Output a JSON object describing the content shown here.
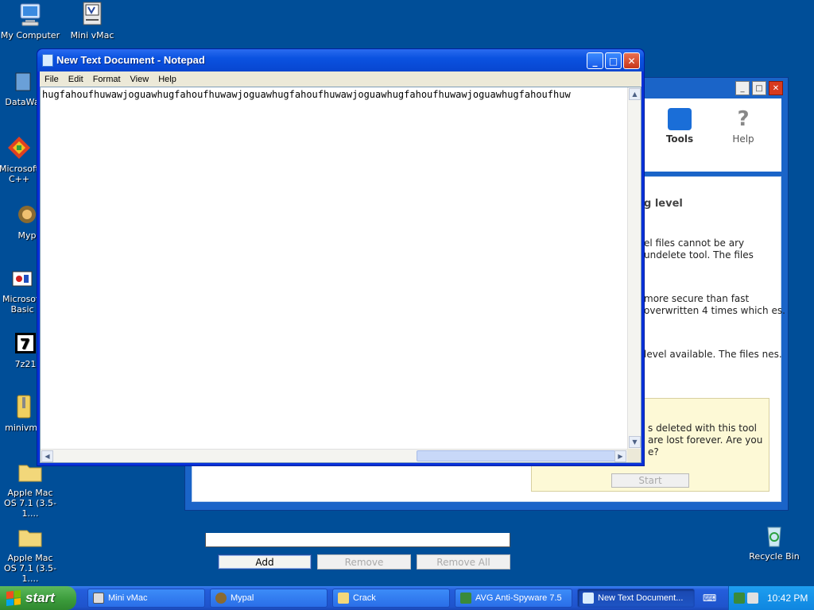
{
  "desktop": {
    "icons": [
      {
        "label": "My Computer"
      },
      {
        "label": "Mini vMac"
      },
      {
        "label": "DataWa"
      },
      {
        "label": "Microsoft C++"
      },
      {
        "label": "Myp"
      },
      {
        "label": "Microsoft Basic"
      },
      {
        "label": "7z21"
      },
      {
        "label": "minivma"
      },
      {
        "label": "Apple Mac OS 7.1 (3.5-1...."
      },
      {
        "label": "Apple Mac OS 7.1 (3.5-1...."
      },
      {
        "label": "Recycle Bin"
      }
    ]
  },
  "avg": {
    "toolbar": {
      "tools_label": "Tools",
      "help_label": "Help"
    },
    "heading": "g level",
    "desc1": "el files cannot be ary undelete tool. The files",
    "desc2": "more secure than fast overwritten 4 times which es.",
    "desc3": "level available. The files nes.",
    "warning": "s deleted with this tool are lost forever. Are you e?",
    "start_label": "Start",
    "add_label": "Add",
    "remove_label": "Remove",
    "remove_all_label": "Remove All"
  },
  "notepad": {
    "title": "New Text Document - Notepad",
    "menu": [
      "File",
      "Edit",
      "Format",
      "View",
      "Help"
    ],
    "content": "hugfahoufhuwawjoguawhugfahoufhuwawjoguawhugfahoufhuwawjoguawhugfahoufhuwawjoguawhugfahoufhuw"
  },
  "taskbar": {
    "start_label": "start",
    "tasks": [
      {
        "label": "Mini vMac"
      },
      {
        "label": "Mypal"
      },
      {
        "label": "Crack"
      },
      {
        "label": "AVG Anti-Spyware 7.5"
      },
      {
        "label": "New Text Document..."
      }
    ],
    "clock": "10:42 PM"
  },
  "colors": {
    "desktop": "#004e98",
    "titlebar": "#0a52e0",
    "start": "#3a9a3a",
    "tray": "#0f86e0"
  }
}
